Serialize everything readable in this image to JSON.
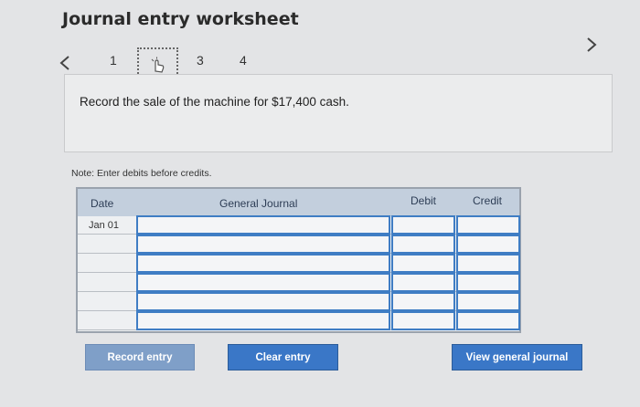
{
  "title": "Journal entry worksheet",
  "nav": {
    "prev_icon": "chevron-left-icon",
    "next_icon": "chevron-right-icon",
    "steps": [
      "1",
      "2",
      "3",
      "4"
    ],
    "current_step": "2"
  },
  "instruction": "Record the sale of the machine for $17,400 cash.",
  "note": "Note: Enter debits before credits.",
  "table": {
    "headers": {
      "date": "Date",
      "general_journal": "General Journal",
      "debit": "Debit",
      "credit": "Credit"
    },
    "rows": [
      {
        "date": "Jan 01",
        "account": "",
        "debit": "",
        "credit": ""
      },
      {
        "date": "",
        "account": "",
        "debit": "",
        "credit": ""
      },
      {
        "date": "",
        "account": "",
        "debit": "",
        "credit": ""
      },
      {
        "date": "",
        "account": "",
        "debit": "",
        "credit": ""
      },
      {
        "date": "",
        "account": "",
        "debit": "",
        "credit": ""
      },
      {
        "date": "",
        "account": "",
        "debit": "",
        "credit": ""
      }
    ]
  },
  "buttons": {
    "record": "Record entry",
    "clear": "Clear entry",
    "view": "View general journal"
  },
  "colors": {
    "accent": "#3a77c7",
    "header_bg": "#c3cfdd",
    "input_border": "#3f7dc4"
  }
}
